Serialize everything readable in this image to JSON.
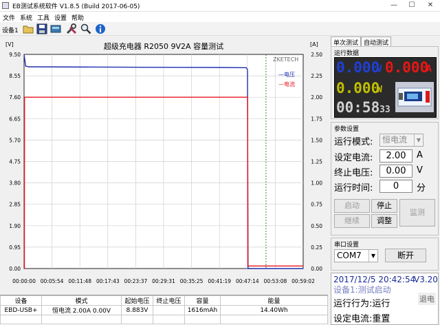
{
  "window": {
    "title": "EB测试系统软件 V1.8.5 (Build 2017-06-05)",
    "minimize": "—",
    "maximize": "☐",
    "close": "✕"
  },
  "menu": [
    "文件",
    "系统",
    "工具",
    "设置",
    "帮助"
  ],
  "toolbar": {
    "device_label": "设备1",
    "buttons": [
      "open-icon",
      "save-icon",
      "screen-icon",
      "tools-icon",
      "zoom-icon",
      "info-icon"
    ]
  },
  "chart_data": {
    "type": "line",
    "title": "超级充电器 R2050 9V2A 容量测试",
    "watermark": "ZKETECH",
    "y_left_unit": "[V]",
    "y_right_unit": "[A]",
    "ylim_left": [
      0,
      9.5
    ],
    "ylim_right": [
      0,
      2.5
    ],
    "y_left_ticks": [
      "9.50",
      "8.55",
      "7.60",
      "6.65",
      "5.70",
      "4.75",
      "3.80",
      "2.85",
      "1.90",
      "0.95",
      "0.00"
    ],
    "y_right_ticks": [
      "2.50",
      "2.25",
      "2.00",
      "1.75",
      "1.50",
      "1.25",
      "1.00",
      "0.75",
      "0.50",
      "0.25",
      "0.00"
    ],
    "x_ticks": [
      "00:00:00",
      "00:05:54",
      "00:11:48",
      "00:17:43",
      "00:23:37",
      "00:29:31",
      "00:35:25",
      "00:41:19",
      "00:47:14",
      "00:53:08",
      "00:59:02"
    ],
    "xlim_seconds": [
      0,
      3542
    ],
    "cursor_x_seconds": 3070,
    "grid": true,
    "legend": [
      "—电压",
      "—电流"
    ],
    "series": [
      {
        "name": "电压",
        "axis": "left",
        "color": "#1f2fb0",
        "points": [
          [
            0,
            9.5
          ],
          [
            8,
            9.3
          ],
          [
            20,
            8.98
          ],
          [
            60,
            8.95
          ],
          [
            1500,
            8.93
          ],
          [
            2500,
            8.92
          ],
          [
            2820,
            8.91
          ],
          [
            2835,
            8.82
          ],
          [
            2842,
            0
          ],
          [
            3542,
            0
          ]
        ]
      },
      {
        "name": "电流",
        "axis": "right",
        "color": "#e8141e",
        "points": [
          [
            0,
            0
          ],
          [
            4,
            0
          ],
          [
            6,
            2.0
          ],
          [
            2836,
            2.0
          ],
          [
            2840,
            0.03
          ],
          [
            3542,
            0.03
          ]
        ]
      }
    ]
  },
  "table": {
    "headers": [
      "设备",
      "模式",
      "起始电压",
      "终止电压",
      "容量",
      "能量"
    ],
    "row": [
      "EBD-USB+",
      "恒电流 2.00A 0.00V",
      "8.883V",
      "",
      "1616mAh",
      "14.40Wh"
    ]
  },
  "tabs": [
    "单次测试",
    "自动测试"
  ],
  "run_data": {
    "title": "运行数据",
    "voltage": "0.000",
    "voltage_unit": "V",
    "current": "0.000",
    "current_unit": "A",
    "power": "0.000",
    "power_unit": "W",
    "time_main": "00:58",
    "time_sec": "33"
  },
  "params": {
    "title": "参数设置",
    "mode_label": "运行模式:",
    "mode_value": "恒电流",
    "current_label": "设定电流:",
    "current_value": "2.00",
    "current_unit": "A",
    "stop_voltage_label": "终止电压:",
    "stop_voltage_value": "0.00",
    "stop_voltage_unit": "V",
    "run_time_label": "运行时间:",
    "run_time_value": "0",
    "run_time_unit": "分",
    "btn_start": "启动",
    "btn_stop": "停止",
    "btn_continue": "继续",
    "btn_adjust": "调整",
    "btn_monitor": "监测"
  },
  "serial": {
    "title": "串口设置",
    "port": "COM7",
    "open_button": "断开"
  },
  "status": {
    "datetime": "2017/12/5 20:42:54",
    "version": "V3.20",
    "line1": "设备1:测试启动",
    "line2": "运行行为:运行",
    "line3": "设定电流:重置",
    "overlay": "退电"
  },
  "colors": {
    "voltage": "#1f2fb0",
    "current": "#e8141e",
    "power": "#b6b600",
    "time": "#c8c8c8",
    "cursor": "#2c8c2c"
  }
}
